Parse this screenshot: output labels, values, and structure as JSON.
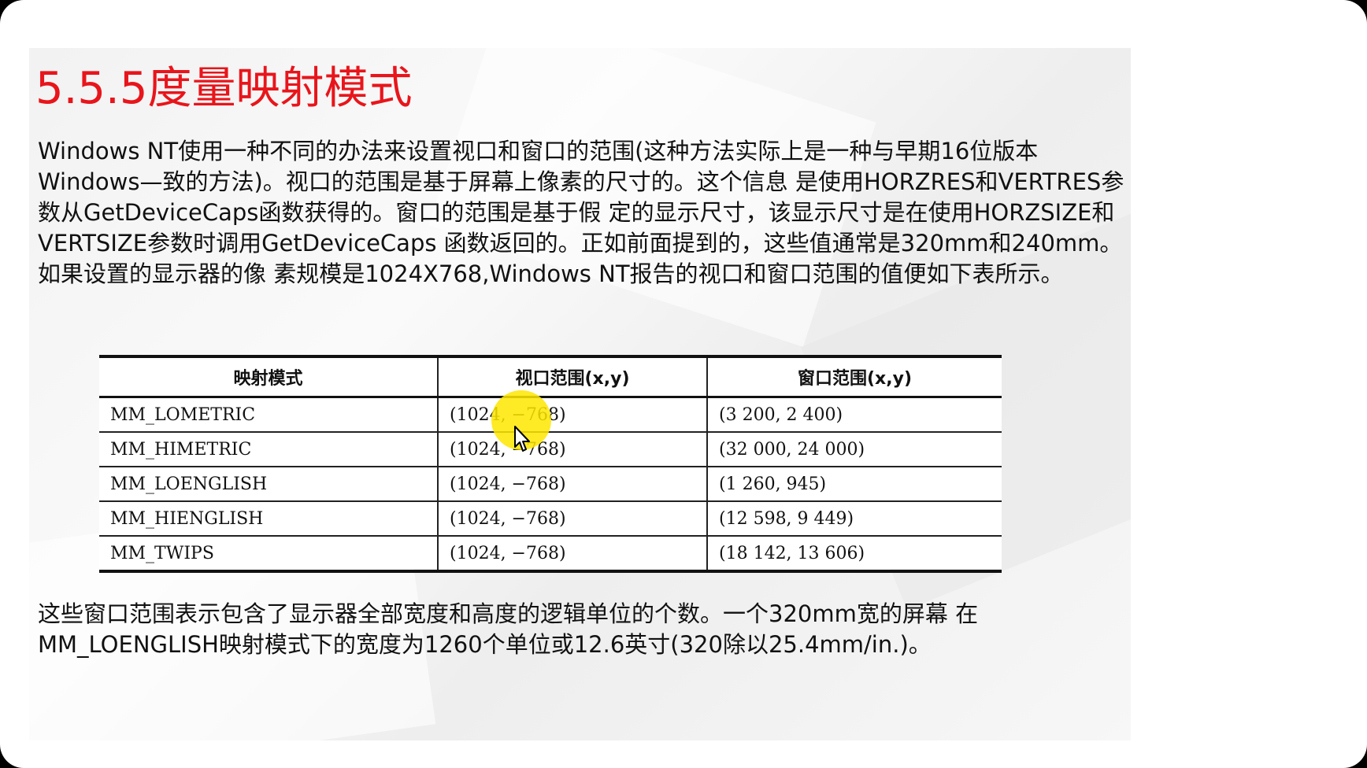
{
  "slide": {
    "title": "5.5.5度量映射模式",
    "paragraph1": "Windows NT使用一种不同的办法来设置视口和窗口的范围(这种方法实际上是一种与早期16位版本Windows—致的方法)。视口的范围是基于屏幕上像素的尺寸的。这个信息 是使用HORZRES和VERTRES参数从GetDeviceCaps函数获得的。窗口的范围是基于假 定的显示尺寸，该显示尺寸是在使用HORZSIZE和VERTSIZE参数时调用GetDeviceCaps 函数返回的。正如前面提到的，这些值通常是320mm和240mm。如果设置的显示器的像 素规模是1024X768,Windows NT报告的视口和窗口范围的值便如下表所示。",
    "paragraph2": "这些窗口范围表示包含了显示器全部宽度和高度的逻辑单位的个数。一个320mm宽的屏幕 在MM_LOENGLISH映射模式下的宽度为1260个单位或12.6英寸(320除以25.4mm/in.)。"
  },
  "table": {
    "headers": [
      "映射模式",
      "视口范围(x,y)",
      "窗口范围(x,y)"
    ],
    "rows": [
      [
        "MM_LOMETRIC",
        "(1024, −768)",
        "(3 200, 2 400)"
      ],
      [
        "MM_HIMETRIC",
        "(1024, −768)",
        "(32 000, 24 000)"
      ],
      [
        "MM_LOENGLISH",
        "(1024, −768)",
        "(1 260, 945)"
      ],
      [
        "MM_HIENGLISH",
        "(1024, −768)",
        "(12 598, 9 449)"
      ],
      [
        "MM_TWIPS",
        "(1024, −768)",
        "(18 142, 13 606)"
      ]
    ]
  },
  "cursor": {
    "icon": "arrow-move-cursor-icon",
    "highlight_color": "#ffe600"
  },
  "colors": {
    "title": "#e8151b",
    "text": "#111111",
    "background": "#ffffff"
  }
}
